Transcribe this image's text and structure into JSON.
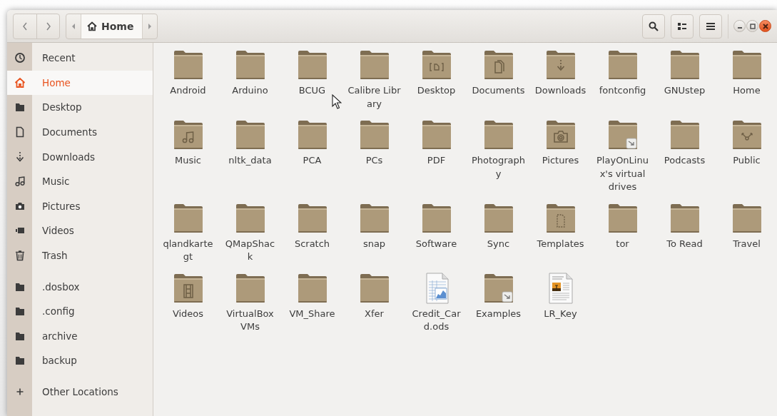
{
  "toolbar": {
    "breadcrumb": [
      {
        "label": "Home",
        "kind": "home",
        "selected": true
      }
    ]
  },
  "sidebar": {
    "sections": [
      {
        "items": [
          {
            "label": "Recent",
            "kind": "recent",
            "selected": false
          },
          {
            "label": "Home",
            "kind": "home",
            "selected": true
          },
          {
            "label": "Desktop",
            "kind": "folder",
            "selected": false
          },
          {
            "label": "Documents",
            "kind": "document",
            "selected": false
          },
          {
            "label": "Downloads",
            "kind": "download",
            "selected": false
          },
          {
            "label": "Music",
            "kind": "music",
            "selected": false
          },
          {
            "label": "Pictures",
            "kind": "camera",
            "selected": false
          },
          {
            "label": "Videos",
            "kind": "video",
            "selected": false
          },
          {
            "label": "Trash",
            "kind": "trash",
            "selected": false
          }
        ]
      },
      {
        "items": [
          {
            "label": ".dosbox",
            "kind": "folder",
            "selected": false
          },
          {
            "label": ".config",
            "kind": "folder",
            "selected": false
          },
          {
            "label": "archive",
            "kind": "folder",
            "selected": false
          },
          {
            "label": "backup",
            "kind": "folder",
            "selected": false
          }
        ]
      },
      {
        "items": [
          {
            "label": "Other Locations",
            "kind": "plus",
            "selected": false
          }
        ]
      }
    ]
  },
  "files": [
    {
      "name": "Android",
      "kind": "folder"
    },
    {
      "name": "Arduino",
      "kind": "folder"
    },
    {
      "name": "BCUG",
      "kind": "folder"
    },
    {
      "name": "Calibre Library",
      "kind": "folder"
    },
    {
      "name": "Desktop",
      "kind": "desktop"
    },
    {
      "name": "Documents",
      "kind": "documents"
    },
    {
      "name": "Downloads",
      "kind": "downloads"
    },
    {
      "name": "fontconfig",
      "kind": "folder"
    },
    {
      "name": "GNUstep",
      "kind": "folder"
    },
    {
      "name": "Home",
      "kind": "folder"
    },
    {
      "name": "Music",
      "kind": "music"
    },
    {
      "name": "nltk_data",
      "kind": "folder"
    },
    {
      "name": "PCA",
      "kind": "folder"
    },
    {
      "name": "PCs",
      "kind": "folder"
    },
    {
      "name": "PDF",
      "kind": "folder"
    },
    {
      "name": "Photography",
      "kind": "folder"
    },
    {
      "name": "Pictures",
      "kind": "pictures"
    },
    {
      "name": "PlayOnLinux's virtual drives",
      "kind": "link"
    },
    {
      "name": "Podcasts",
      "kind": "folder"
    },
    {
      "name": "Public",
      "kind": "public"
    },
    {
      "name": "qlandkartegt",
      "kind": "folder"
    },
    {
      "name": "QMapShack",
      "kind": "folder"
    },
    {
      "name": "Scratch",
      "kind": "folder"
    },
    {
      "name": "snap",
      "kind": "folder"
    },
    {
      "name": "Software",
      "kind": "folder"
    },
    {
      "name": "Sync",
      "kind": "folder"
    },
    {
      "name": "Templates",
      "kind": "templates"
    },
    {
      "name": "tor",
      "kind": "folder"
    },
    {
      "name": "To Read",
      "kind": "folder"
    },
    {
      "name": "Travel",
      "kind": "folder"
    },
    {
      "name": "Videos",
      "kind": "videos"
    },
    {
      "name": "VirtualBox VMs",
      "kind": "folder"
    },
    {
      "name": "VM_Share",
      "kind": "folder"
    },
    {
      "name": "Xfer",
      "kind": "folder"
    },
    {
      "name": "Credit_Card.ods",
      "kind": "spreadsheet"
    },
    {
      "name": "Examples",
      "kind": "link"
    },
    {
      "name": "LR_Key",
      "kind": "image"
    }
  ]
}
